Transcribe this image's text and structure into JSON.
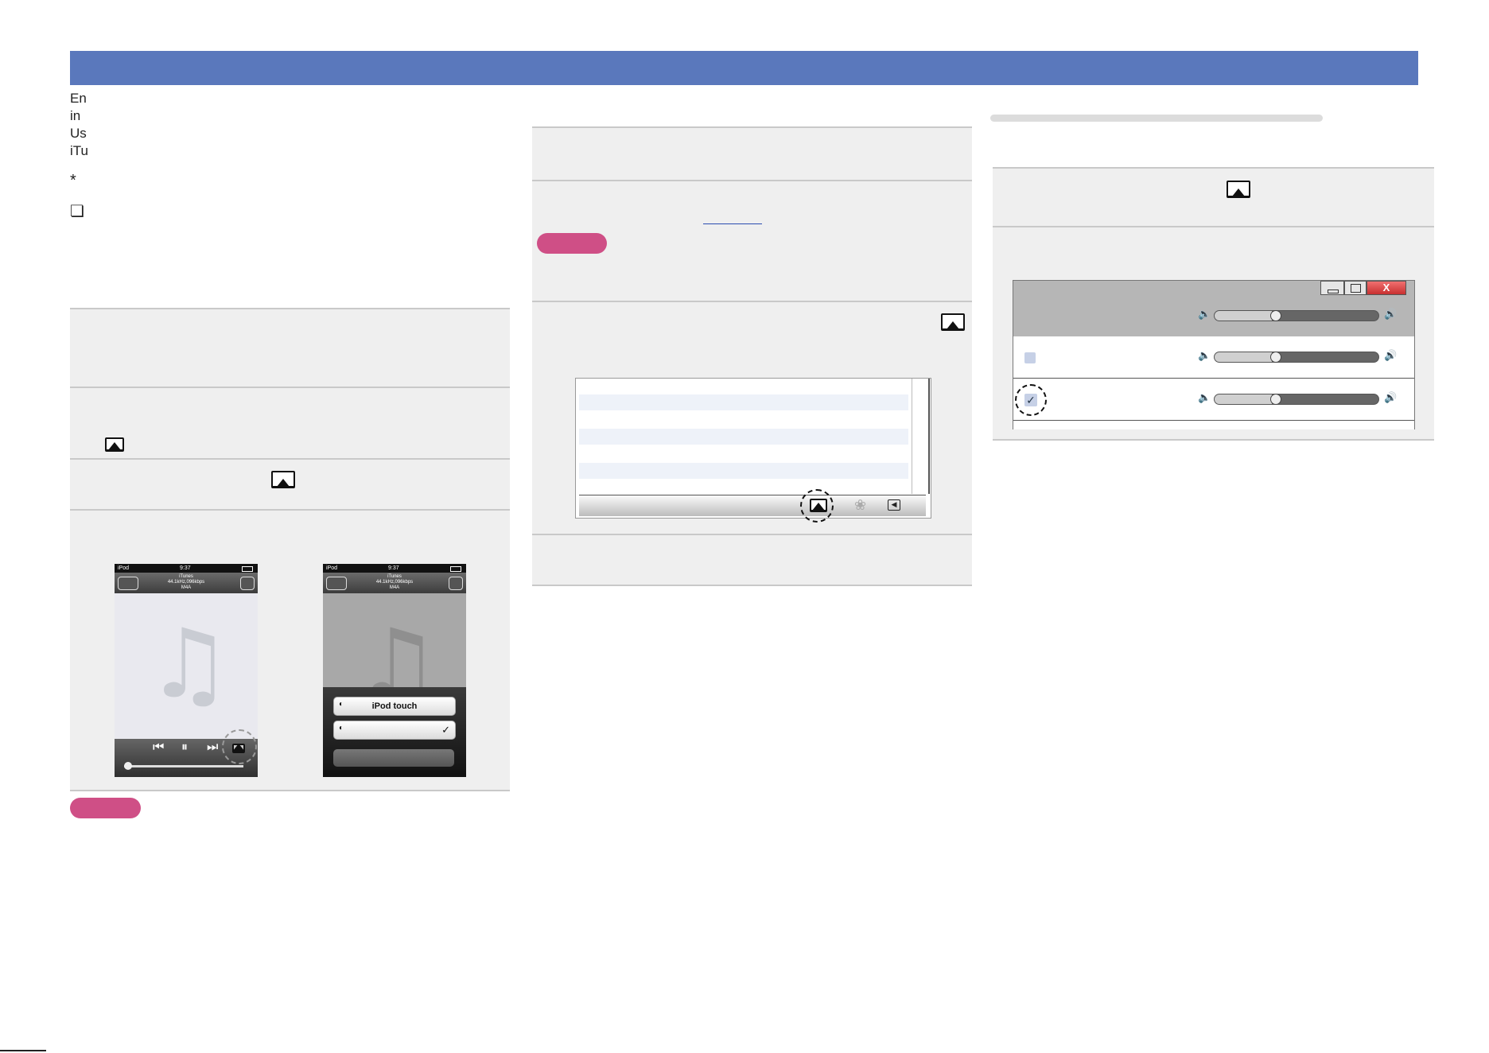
{
  "margin_text": {
    "line1": "En",
    "line2": "in",
    "line3": "Us",
    "line4": "iTu",
    "asterisk": "*",
    "checkbox_glyph": "❏"
  },
  "icons": {
    "airplay": "airplay-icon",
    "music_note": "♫",
    "speaker_low": "🔈",
    "speaker_high": "🔊",
    "check": "✓",
    "close": "X"
  },
  "phone_left": {
    "status_left": "iPod",
    "status_time": "9:37",
    "nav_line1": "iTunes",
    "nav_line2": "44.1kHz,096kbps",
    "nav_line3": "M4A"
  },
  "phone_right": {
    "status_left": "iPod",
    "status_time": "9:37",
    "nav_line1": "iTunes",
    "nav_line2": "44.1kHz,096kbps",
    "nav_line3": "M4A",
    "menu_item_1": "iPod touch",
    "menu_item_2_check": "✓"
  },
  "colors": {
    "header_bar": "#5a78bc",
    "note_pill": "#cf4f86",
    "step_background": "#efefef",
    "window_close": "#e05050"
  }
}
